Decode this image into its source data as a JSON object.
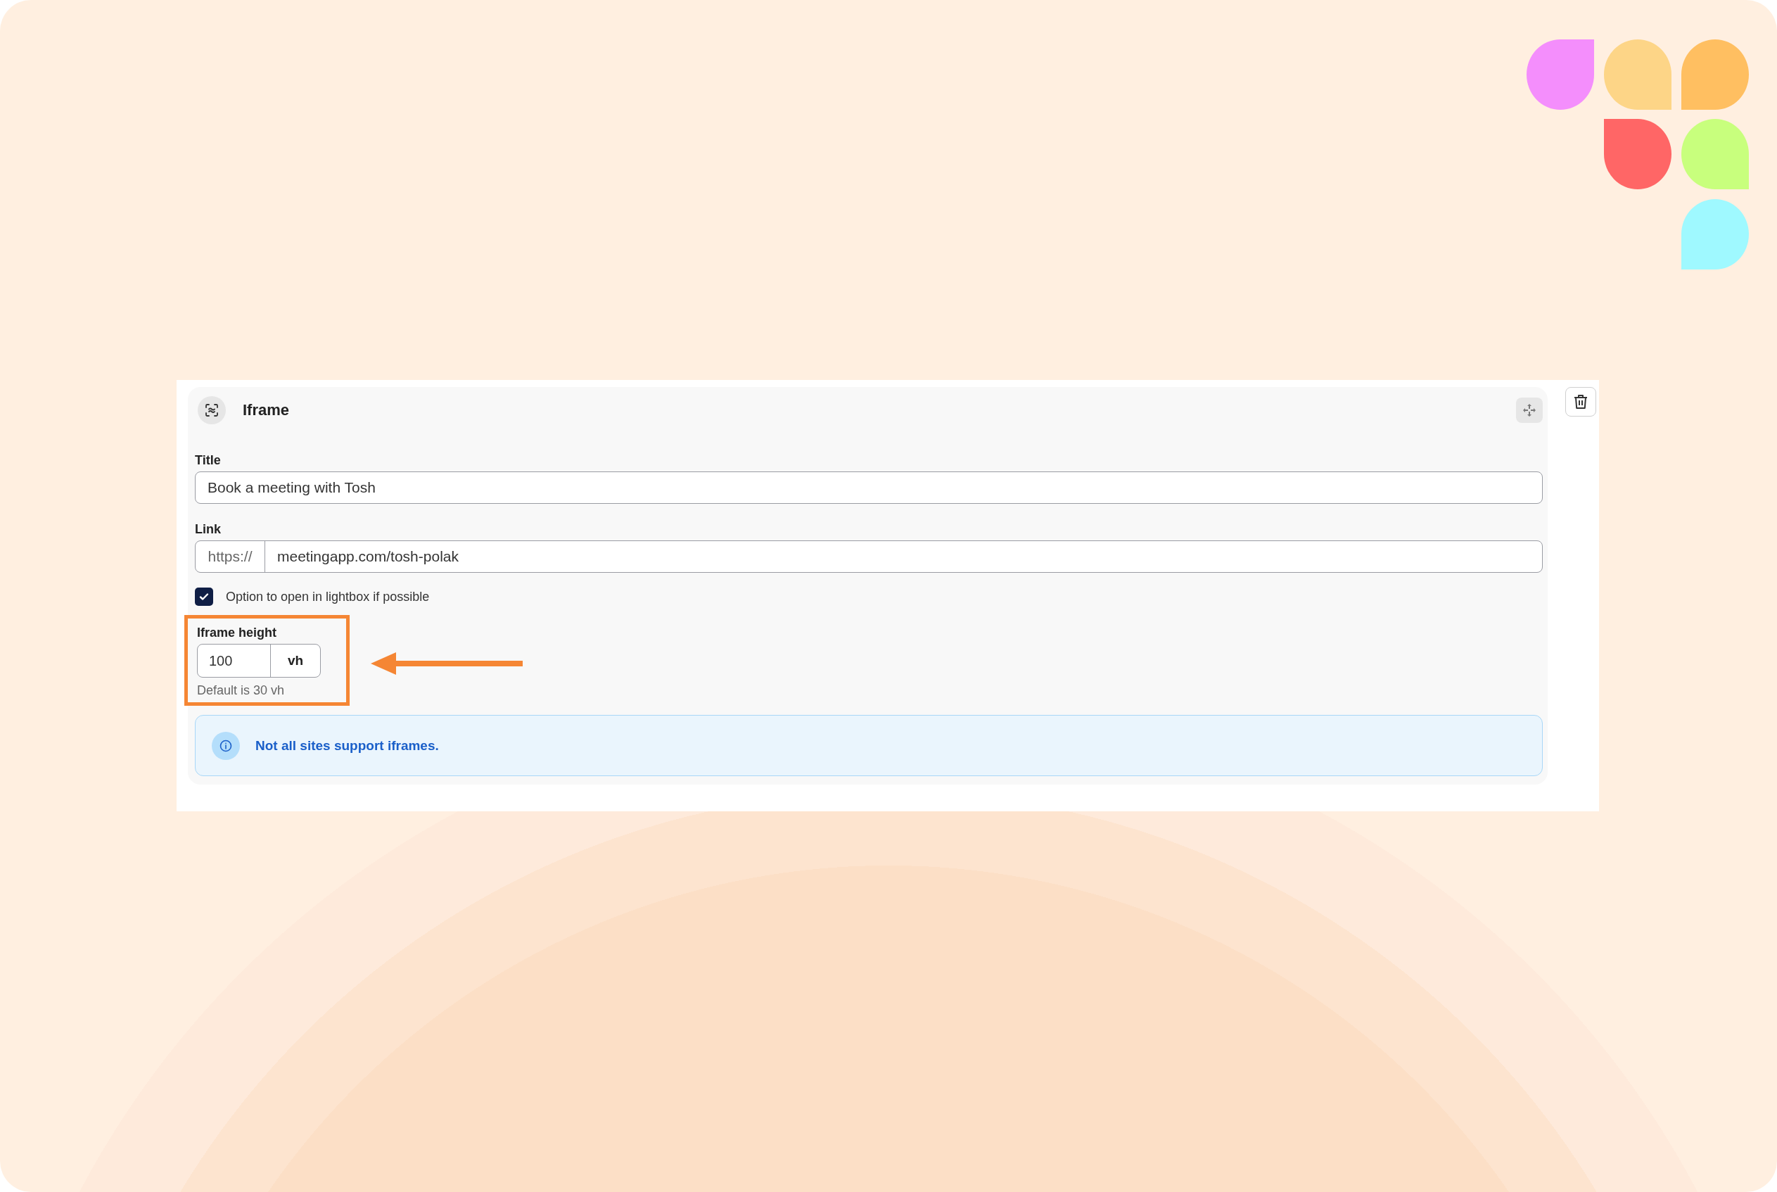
{
  "card": {
    "title": "Iframe"
  },
  "fields": [
    {
      "label": "Title",
      "value": "Book a meeting with Tosh"
    },
    {
      "label": "Link",
      "prefix": "https://",
      "value": "meetingapp.com/tosh-polak"
    }
  ],
  "lightbox_option": {
    "label": "Option to open in lightbox if possible",
    "checked": true
  },
  "height_field": {
    "label": "Iframe height",
    "value": "100",
    "unit": "vh",
    "hint": "Default is 30 vh",
    "highlighted": true
  },
  "notice": {
    "text": "Not all sites support iframes."
  }
}
